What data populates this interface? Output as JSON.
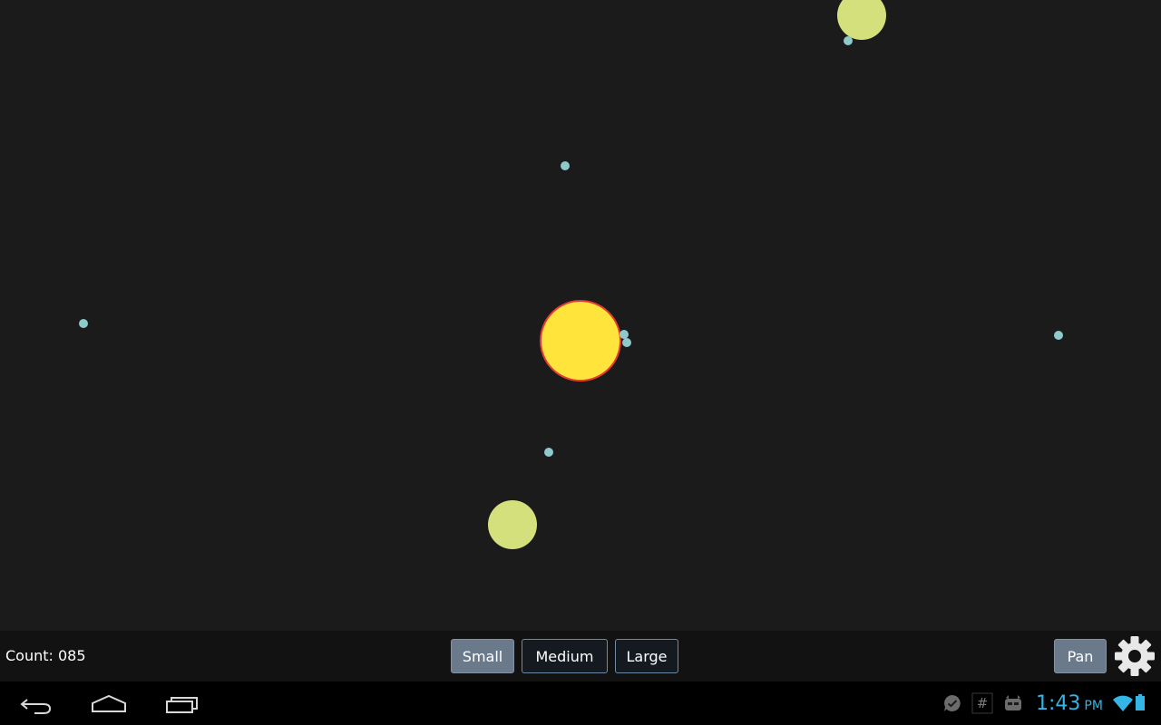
{
  "toolbar": {
    "count_label": "Count: 085",
    "size_buttons": {
      "small": "Small",
      "medium": "Medium",
      "large": "Large"
    },
    "selected_size": "Small",
    "pan_label": "Pan",
    "settings_icon": "gear-icon"
  },
  "navbar": {
    "icons": [
      "back-icon",
      "home-icon",
      "recent-apps-icon"
    ]
  },
  "status_bar": {
    "icons": [
      "chat-notification-icon",
      "hash-notification-icon",
      "android-debug-icon",
      "wifi-icon",
      "battery-icon"
    ],
    "time": "1:43",
    "ampm": "PM"
  },
  "colors": {
    "canvas_bg": "#1b1b1b",
    "sun_fill": "#ffe53b",
    "sun_stroke": "#e53935",
    "planet_fill": "#d4e07c",
    "particle_fill": "#8ec9cc",
    "clock": "#33b5e5"
  }
}
